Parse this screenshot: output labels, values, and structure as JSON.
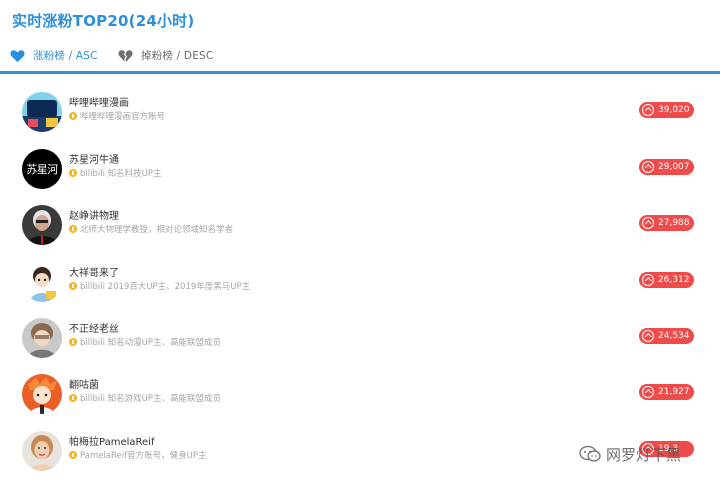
{
  "title": "实时涨粉TOP20(24小时)",
  "tabs": [
    {
      "label": "涨粉榜 / ASC",
      "icon": "heart-icon",
      "active": true
    },
    {
      "label": "掉粉榜 / DESC",
      "icon": "broken-heart-icon",
      "active": false
    }
  ],
  "colors": {
    "accent": "#2d8fdc",
    "badge": "#f04b4b",
    "verified": "#f5b324"
  },
  "rows": [
    {
      "name": "哔哩哔哩漫画",
      "desc": "哔哩哔哩漫画官方账号",
      "count": "39,020"
    },
    {
      "name": "苏星河牛通",
      "desc": "bilibili 知名科技UP主",
      "count": "29,007"
    },
    {
      "name": "赵峥讲物理",
      "desc": "北师大物理学教授，相对论领域知名学者",
      "count": "27,988"
    },
    {
      "name": "大祥哥来了",
      "desc": "bilibili 2019百大UP主、2019年度黑马UP主",
      "count": "26,312"
    },
    {
      "name": "不正经老丝",
      "desc": "bilibili 知名动漫UP主、高能联盟成员",
      "count": "24,534"
    },
    {
      "name": "翻咕菌",
      "desc": "bilibili 知名游戏UP主、高能联盟成员",
      "count": "21,927"
    },
    {
      "name": "帕梅拉PamelaReif",
      "desc": "PamelaReif官方账号，健身UP主",
      "count": "19,3"
    }
  ],
  "avatars": [
    "manga-avatar-text",
    "苏星河"
  ],
  "watermark": "网罗灯下黑"
}
